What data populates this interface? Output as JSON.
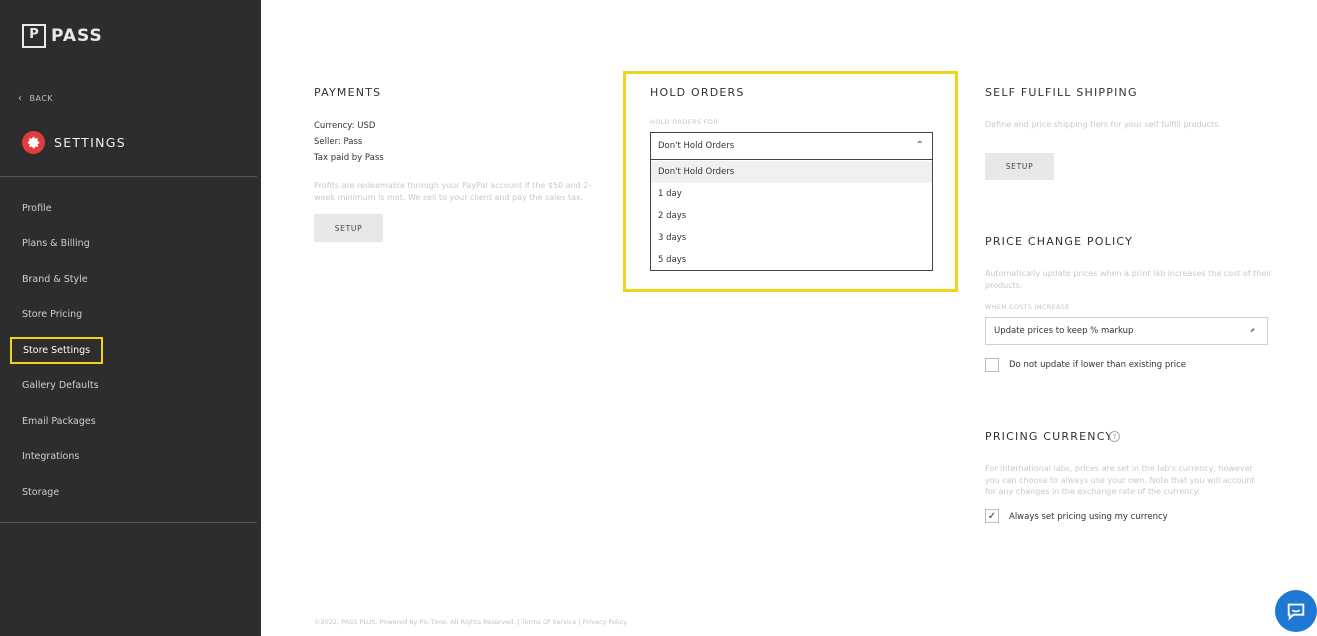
{
  "brand": {
    "logo_letter": "P",
    "name": "PASS"
  },
  "sidebar": {
    "back_label": "BACK",
    "section_title": "SETTINGS",
    "items": [
      {
        "label": "Profile"
      },
      {
        "label": "Plans & Billing"
      },
      {
        "label": "Brand & Style"
      },
      {
        "label": "Store Pricing"
      },
      {
        "label": "Store Settings",
        "active": true
      },
      {
        "label": "Gallery Defaults"
      },
      {
        "label": "Email Packages"
      },
      {
        "label": "Integrations"
      },
      {
        "label": "Storage"
      }
    ]
  },
  "payments": {
    "title": "PAYMENTS",
    "currency": "Currency: USD",
    "seller": "Seller: Pass",
    "tax": "Tax paid by Pass",
    "description": "Profits are redeemable through your PayPal account if the $50 and 2-week minimum is met. We sell to your client and pay the sales tax.",
    "button": "SETUP"
  },
  "hold_orders": {
    "title": "HOLD ORDERS",
    "field_label": "HOLD ORDERS FOR",
    "selected": "Don't Hold Orders",
    "options": [
      "Don't Hold Orders",
      "1 day",
      "2 days",
      "3 days",
      "5 days"
    ]
  },
  "self_fulfill": {
    "title": "SELF FULFILL SHIPPING",
    "description": "Define and price shipping tiers for your self fulfill products.",
    "button": "SETUP"
  },
  "price_change": {
    "title": "PRICE CHANGE POLICY",
    "description": "Automatically update prices when a print lab increases the cost of their products.",
    "field_label": "WHEN COSTS INCREASE",
    "selected": "Update prices to keep % markup",
    "checkbox_label": "Do not update if lower than existing price",
    "checkbox_checked": false
  },
  "pricing_currency": {
    "title": "PRICING CURRENCY",
    "help_glyph": "?",
    "description": "For international labs, prices are set in the lab's currency, however you can choose to always use your own. Note that you will account for any changes in the exchange rate of the currency.",
    "checkbox_label": "Always set pricing using my currency",
    "checkbox_checked": true,
    "check_glyph": "✓"
  },
  "footer": {
    "text": "©2022, PASS PLUS. Powered by Pic-Time. All Rights Reserved.",
    "sep1": "|",
    "terms": "Terms Of Service",
    "sep2": "|",
    "privacy": "Privacy Policy"
  },
  "colors": {
    "sidebar_bg": "#2e2d2e",
    "highlight": "#f2d21b",
    "gear_red": "#e23d3d",
    "chat_blue": "#1f78d1"
  },
  "icons": {
    "back": "chevron-left-icon",
    "settings": "gear-icon",
    "dropdown": "chevron-up-icon",
    "help": "question-circle-icon",
    "chat": "chat-bubble-icon"
  }
}
